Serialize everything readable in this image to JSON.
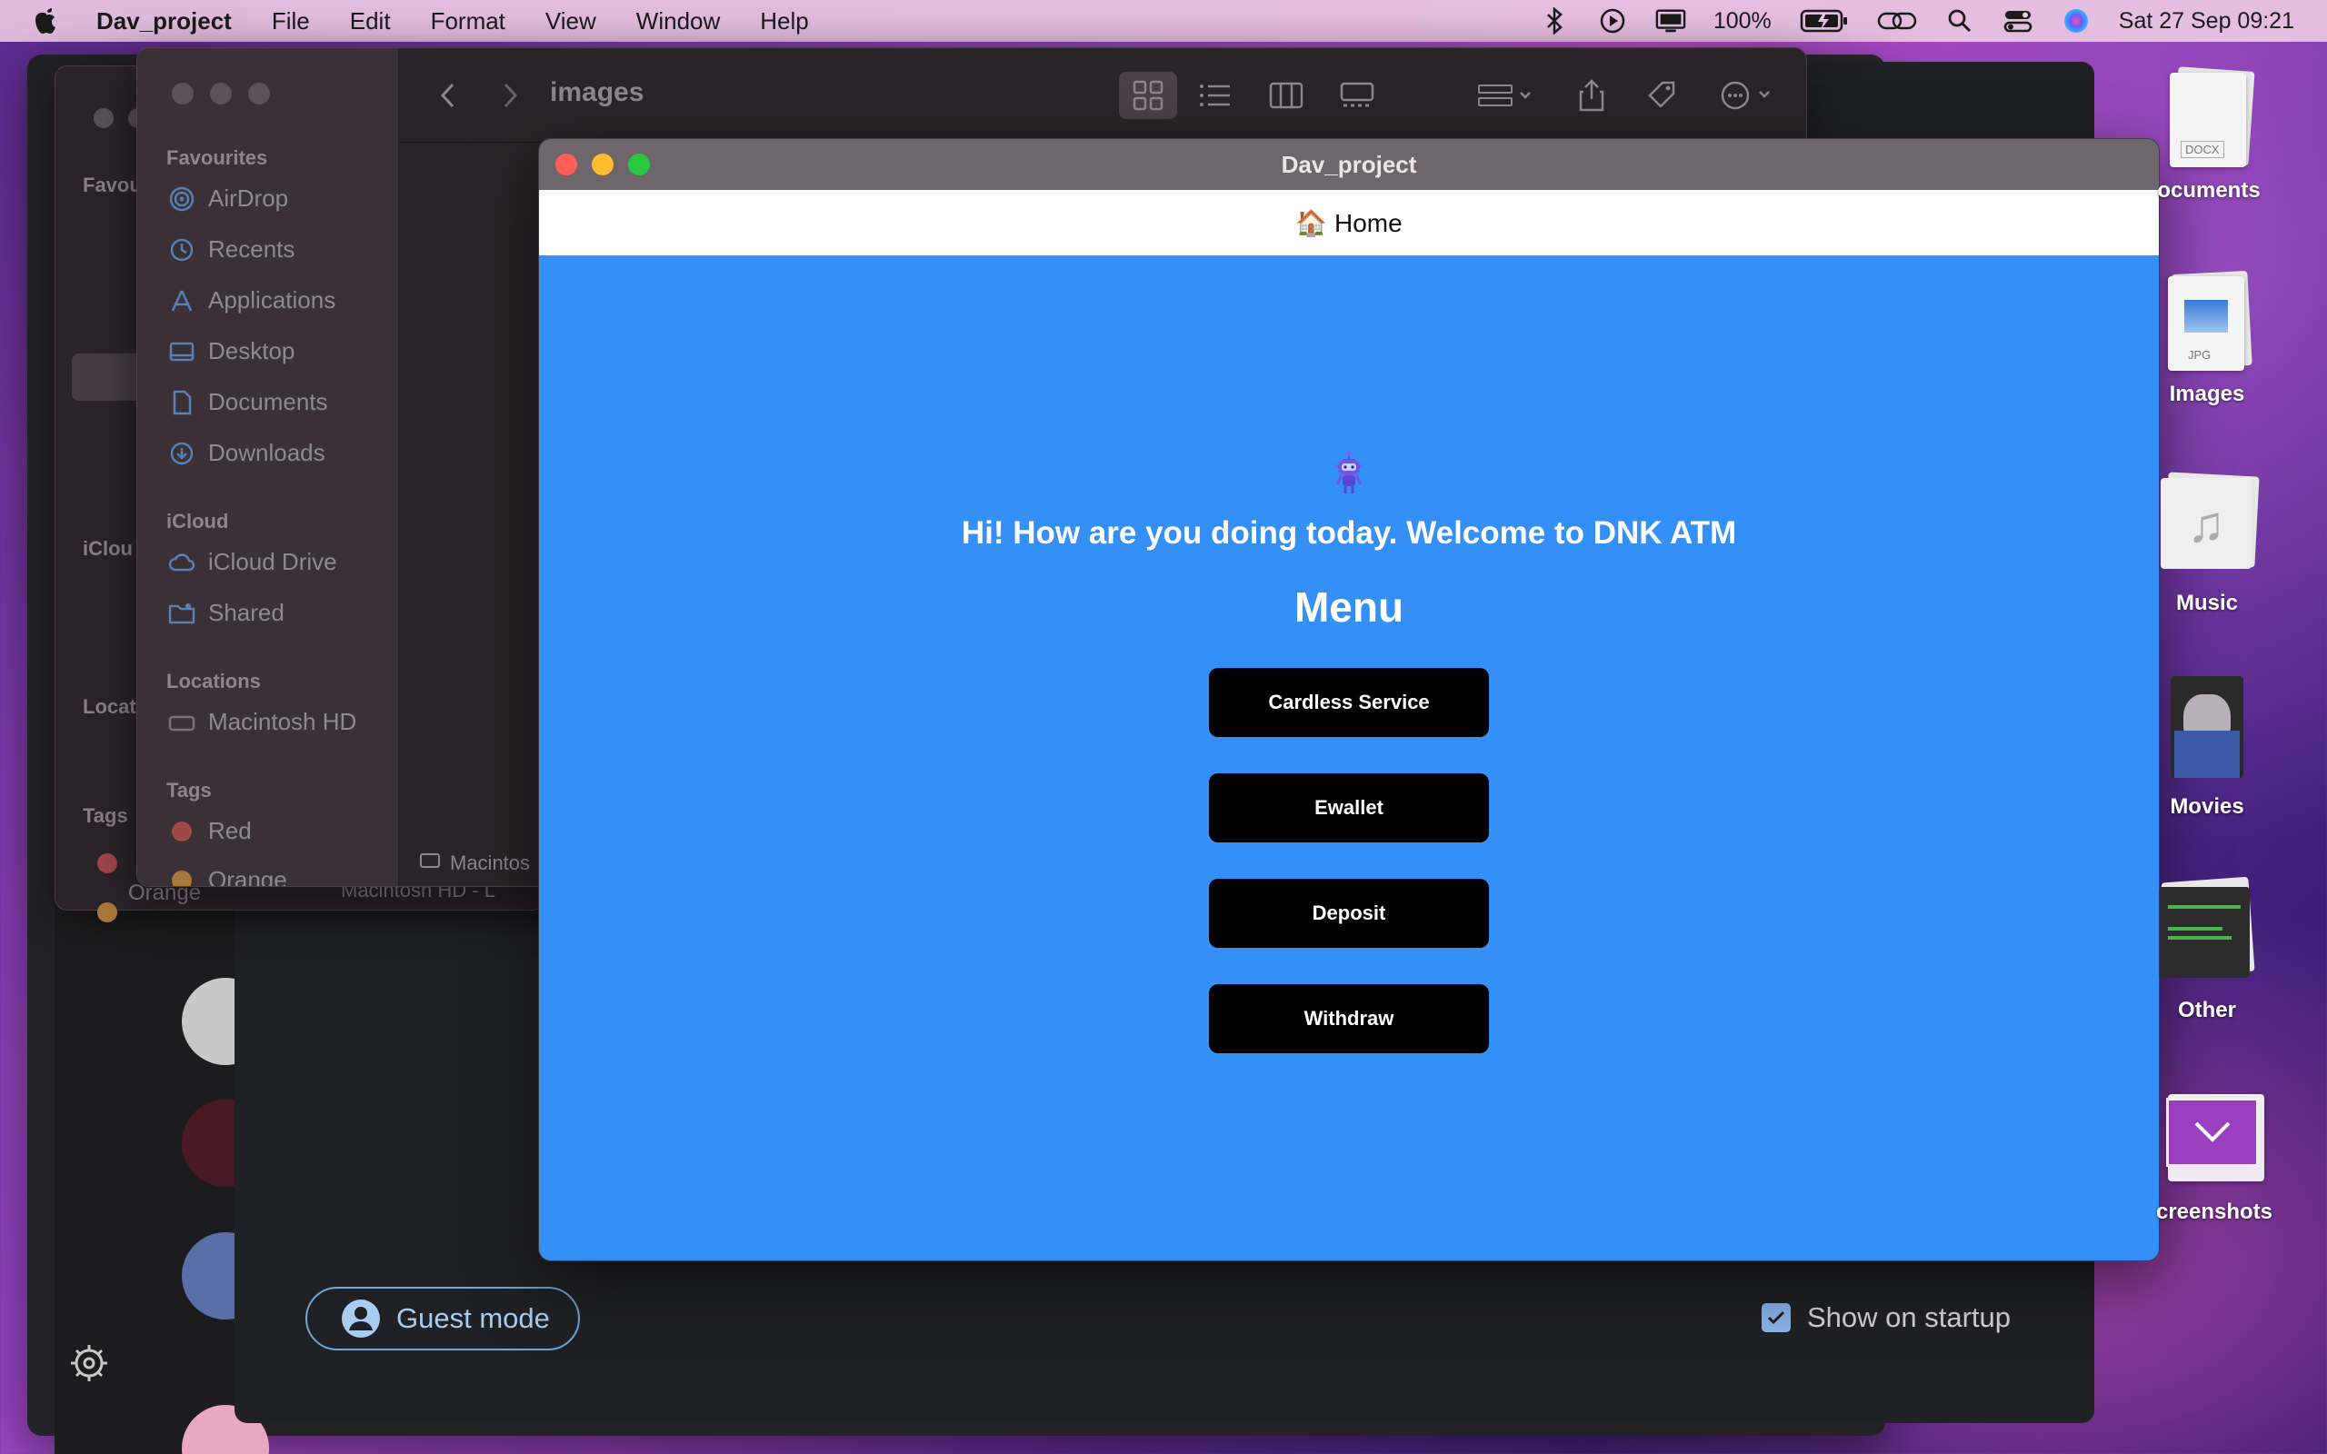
{
  "menubar": {
    "app_name": "Dav_project",
    "items": [
      "File",
      "Edit",
      "Format",
      "View",
      "Window",
      "Help"
    ],
    "battery": "100%",
    "datetime": "Sat 27 Sep  09:21"
  },
  "finder": {
    "toolbar_title": "images",
    "sections": {
      "favourites": "Favourites",
      "icloud": "iCloud",
      "locations": "Locations",
      "tags": "Tags"
    },
    "favourites": [
      "AirDrop",
      "Recents",
      "Applications",
      "Desktop",
      "Documents",
      "Downloads"
    ],
    "icloud_items": [
      "iCloud Drive",
      "Shared"
    ],
    "location_items": [
      "Macintosh HD"
    ],
    "tags": [
      {
        "label": "Red",
        "color": "#a04848"
      },
      {
        "label": "Orange",
        "color": "#a8793a"
      }
    ],
    "pathbar": "Macintos"
  },
  "finder_back": {
    "sections": [
      "Favou",
      "iClou",
      "Locat",
      "Tags"
    ],
    "pathbar": "Macintosh HD - L",
    "tag_orange": "Orange"
  },
  "app": {
    "window_title": "Dav_project",
    "nav_icon": "🏠",
    "nav_home": "Home",
    "welcome": "Hi! How are you doing today. Welcome to DNK ATM",
    "menu_heading": "Menu",
    "buttons": [
      "Cardless Service",
      "Ewallet",
      "Deposit",
      "Withdraw"
    ],
    "background_color": "#3490f7"
  },
  "chrome_bg": {
    "guest_mode": "Guest mode",
    "show_on_startup": "Show on startup"
  },
  "desktop": {
    "icons": [
      {
        "label": "ocuments",
        "badge": "DOCX"
      },
      {
        "label": "Images",
        "badge": "JPG"
      },
      {
        "label": "Music",
        "badge": ""
      },
      {
        "label": "Movies",
        "badge": ""
      },
      {
        "label": "Other",
        "badge": ""
      },
      {
        "label": "creenshots",
        "badge": ""
      }
    ]
  }
}
